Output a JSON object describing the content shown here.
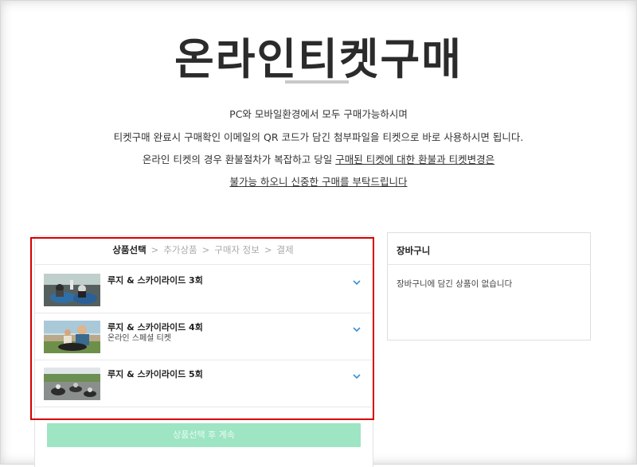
{
  "page": {
    "title": "온라인티켓구매",
    "intro_line1": "PC와 모바일환경에서 모두 구매가능하시며",
    "intro_line2": "티켓구매 완료시 구매확인 이메일의 QR 코드가 담긴 첨부파일을 티켓으로 바로 사용하시면 됩니다.",
    "intro_line3_prefix": "온라인 티켓의 경우 환불절차가 복잡하고 당일 ",
    "intro_line3_underlined": "구매된 티켓에 대한 환불과 티켓변경은",
    "intro_line4": "불가능 하오니 신중한 구매를 부탁드립니다"
  },
  "steps": [
    {
      "label": "상품선택",
      "active": true
    },
    {
      "label": "추가상품",
      "active": false
    },
    {
      "label": "구매자 정보",
      "active": false
    },
    {
      "label": "결제",
      "active": false
    }
  ],
  "steps_separator": ">",
  "products": [
    {
      "name": "루지 & 스카이라이드 3회",
      "subtitle": ""
    },
    {
      "name": "루지 & 스카이라이드 4회",
      "subtitle": "온라인 스페셜 티켓"
    },
    {
      "name": "루지 & 스카이라이드 5회",
      "subtitle": ""
    }
  ],
  "product_toggle_icon": "chevron-down-icon",
  "next_button": {
    "label": "상품선택 후 계속"
  },
  "cart": {
    "title": "장바구니",
    "empty_message": "장바구니에 담긴 상품이 없습니다"
  },
  "colors": {
    "accent_mint": "#9ee5c4",
    "chevron_blue": "#3a8fd6",
    "highlight_red": "#d40000"
  }
}
